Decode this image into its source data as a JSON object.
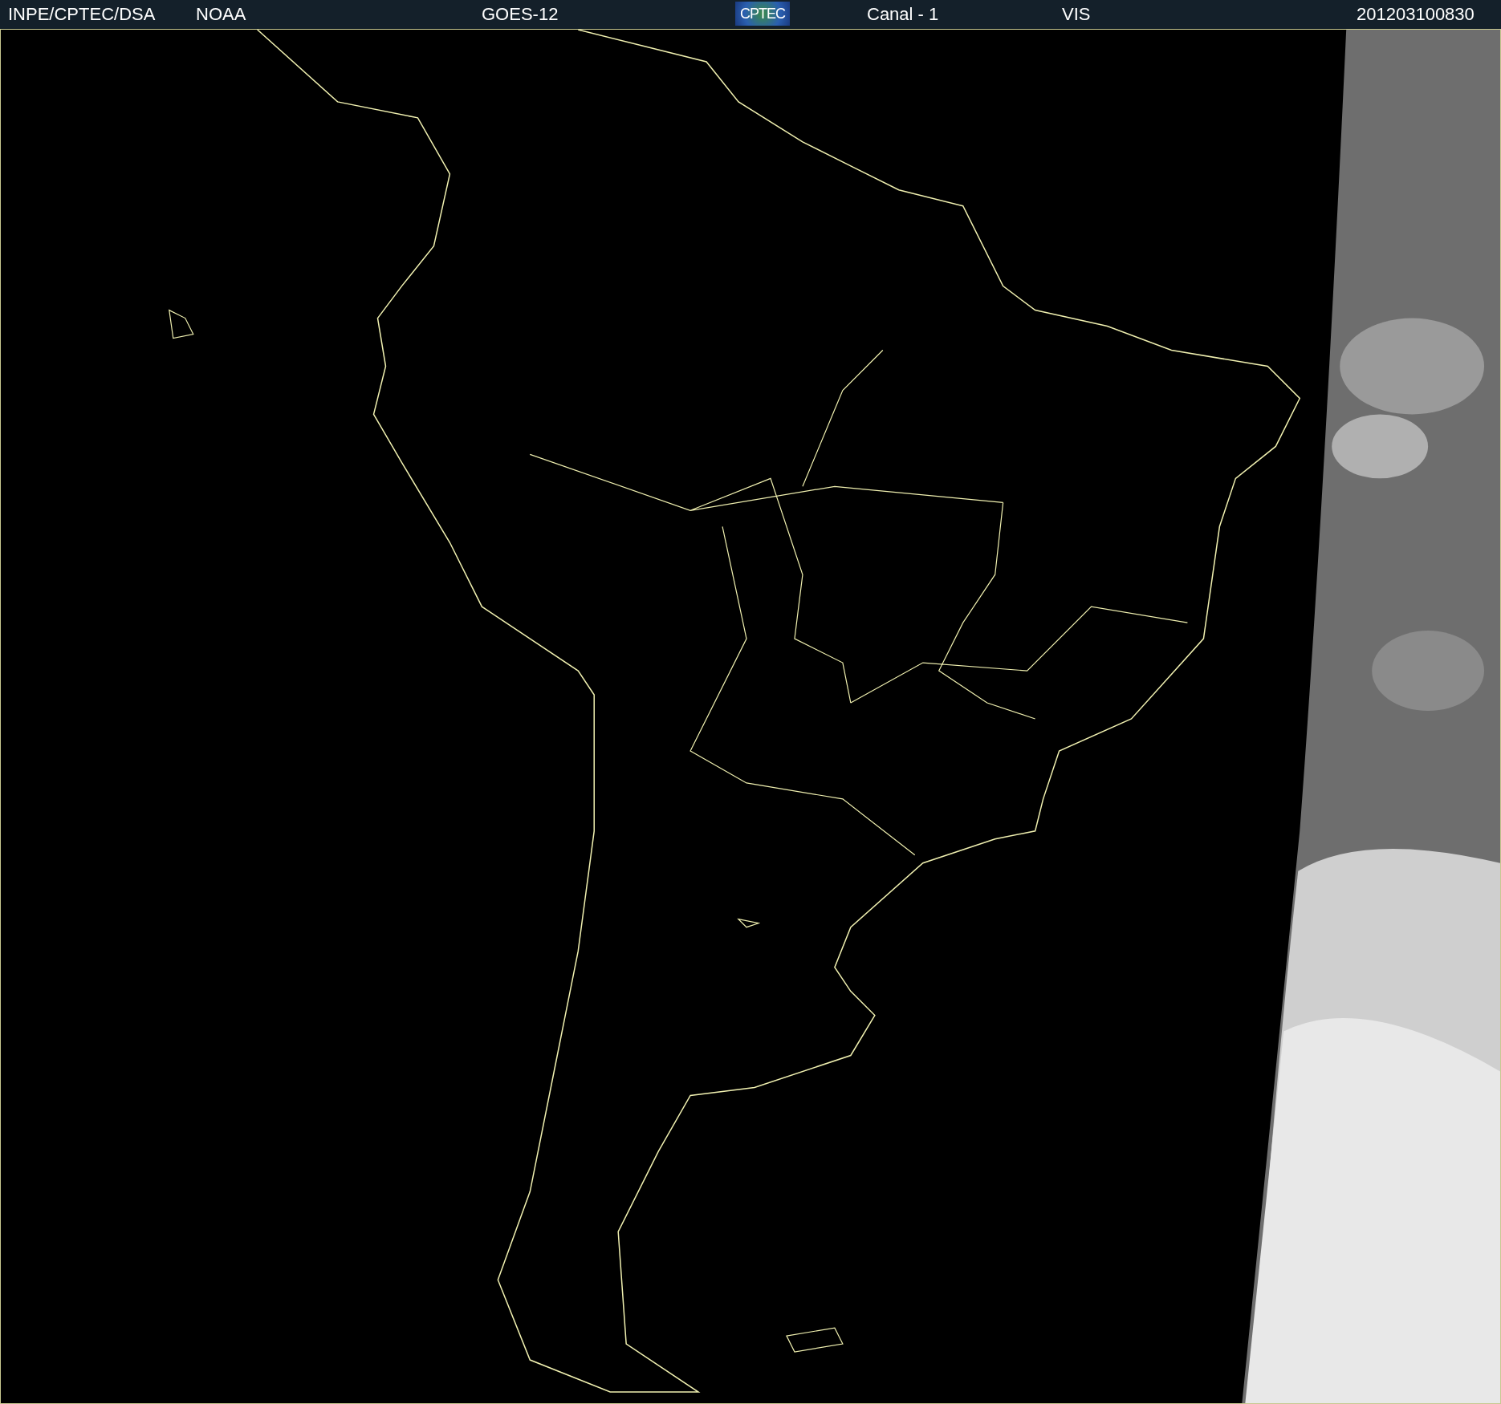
{
  "header": {
    "items": [
      {
        "text": "INPE/CPTEC/DSA"
      },
      {
        "text": "NOAA"
      },
      {
        "text": "GOES-12"
      },
      {
        "text": "CPTEC",
        "kind": "logo"
      },
      {
        "text": "Canal - 1"
      },
      {
        "text": "VIS"
      },
      {
        "text": "201203100830"
      }
    ]
  }
}
